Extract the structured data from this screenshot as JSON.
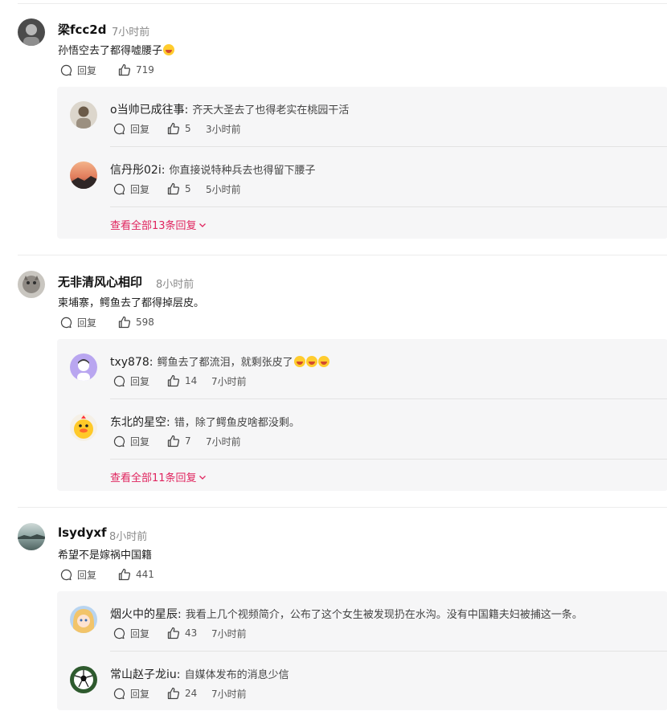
{
  "comments": [
    {
      "username": "梁fcc2d",
      "time": "7小时前",
      "text": "孙悟空去了都得嘘腰子",
      "reply_label": "回复",
      "likes": "719",
      "replies": [
        {
          "username": "o当帅已成往事:",
          "text": "齐天大圣去了也得老实在桃园干活",
          "reply_label": "回复",
          "likes": "5",
          "time": "3小时前"
        },
        {
          "username": "信丹彤02i:",
          "text": "你直接说特种兵去也得留下腰子",
          "reply_label": "回复",
          "likes": "5",
          "time": "5小时前"
        }
      ],
      "view_all": "查看全部13条回复"
    },
    {
      "username": "无非清风心相印",
      "time": "8小时前",
      "text": "柬埔寨，鳄鱼去了都得掉层皮。",
      "reply_label": "回复",
      "likes": "598",
      "replies": [
        {
          "username": "txy878:",
          "text": "鳄鱼去了都流泪，就剩张皮了",
          "reply_label": "回复",
          "likes": "14",
          "time": "7小时前"
        },
        {
          "username": "东北的星空:",
          "text": "错，除了鳄鱼皮啥都没剩。",
          "reply_label": "回复",
          "likes": "7",
          "time": "7小时前"
        }
      ],
      "view_all": "查看全部11条回复"
    },
    {
      "username": "lsydyxf",
      "time": "8小时前",
      "text": "希望不是嫁祸中国籍",
      "reply_label": "回复",
      "likes": "441",
      "replies": [
        {
          "username": "烟火中的星辰:",
          "text": "我看上几个视频简介，公布了这个女生被发现扔在水沟。没有中国籍夫妇被捕这一条。",
          "reply_label": "回复",
          "likes": "43",
          "time": "7小时前"
        },
        {
          "username": "常山赵子龙iu:",
          "text": "自媒体发布的消息少信",
          "reply_label": "回复",
          "likes": "24",
          "time": "7小时前"
        }
      ]
    }
  ],
  "colors": {
    "accent": "#e0245e",
    "reply_bg": "#f6f6f7",
    "muted": "#8a8a8a"
  }
}
